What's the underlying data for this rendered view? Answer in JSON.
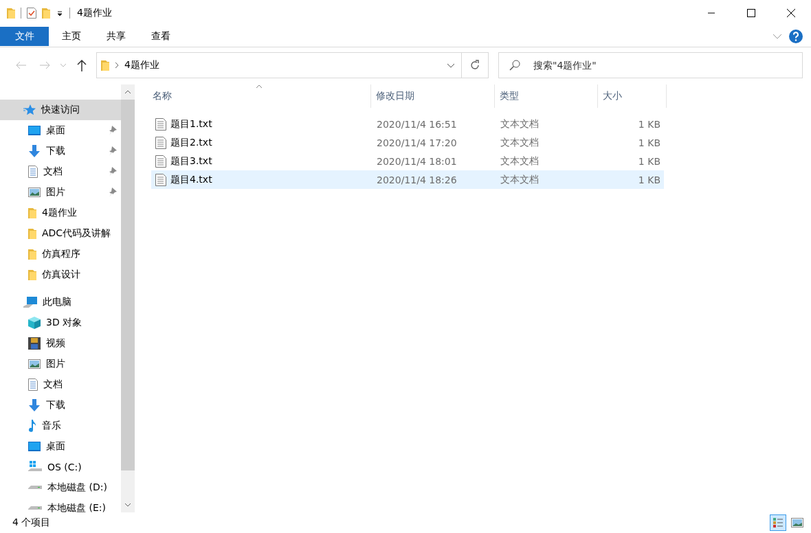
{
  "title_bar": {
    "title": "4题作业"
  },
  "ribbon": {
    "tabs": [
      {
        "label": "文件",
        "kind": "file"
      },
      {
        "label": "主页",
        "kind": "tab"
      },
      {
        "label": "共享",
        "kind": "tab"
      },
      {
        "label": "查看",
        "kind": "tab"
      }
    ]
  },
  "address_bar": {
    "path": "4题作业"
  },
  "search": {
    "placeholder": "搜索\"4题作业\""
  },
  "sidebar": {
    "items": [
      {
        "label": "快速访问",
        "kind": "star",
        "selected": true,
        "children": [
          {
            "label": "桌面",
            "kind": "desktop",
            "pinned": true,
            "selected": false
          },
          {
            "label": "下载",
            "kind": "download",
            "pinned": true,
            "selected": false
          },
          {
            "label": "文档",
            "kind": "document",
            "pinned": true,
            "selected": false
          },
          {
            "label": "图片",
            "kind": "picture",
            "pinned": true,
            "selected": false
          },
          {
            "label": "4题作业",
            "kind": "folder",
            "pinned": false,
            "selected": false
          },
          {
            "label": "ADC代码及讲解",
            "kind": "folder",
            "pinned": false,
            "selected": false
          },
          {
            "label": "仿真程序",
            "kind": "folder",
            "pinned": false,
            "selected": false
          },
          {
            "label": "仿真设计",
            "kind": "folder",
            "pinned": false,
            "selected": false
          }
        ]
      },
      {
        "label": "此电脑",
        "kind": "pc",
        "selected": false,
        "children": [
          {
            "label": "3D 对象",
            "kind": "cube",
            "pinned": false,
            "selected": false
          },
          {
            "label": "视频",
            "kind": "video",
            "pinned": false,
            "selected": false
          },
          {
            "label": "图片",
            "kind": "picture",
            "pinned": false,
            "selected": false
          },
          {
            "label": "文档",
            "kind": "document",
            "pinned": false,
            "selected": false
          },
          {
            "label": "下载",
            "kind": "download",
            "pinned": false,
            "selected": false
          },
          {
            "label": "音乐",
            "kind": "music",
            "pinned": false,
            "selected": false
          },
          {
            "label": "桌面",
            "kind": "desktop",
            "pinned": false,
            "selected": false
          },
          {
            "label": "OS (C:)",
            "kind": "windrive",
            "pinned": false,
            "selected": false
          },
          {
            "label": "本地磁盘 (D:)",
            "kind": "drive",
            "pinned": false,
            "selected": false
          },
          {
            "label": "本地磁盘 (E:)",
            "kind": "drive",
            "pinned": false,
            "selected": false
          }
        ]
      }
    ]
  },
  "file_list": {
    "columns": [
      {
        "label": "名称",
        "sorted": true
      },
      {
        "label": "修改日期",
        "sorted": false
      },
      {
        "label": "类型",
        "sorted": false
      },
      {
        "label": "大小",
        "sorted": false
      }
    ],
    "rows": [
      {
        "name": "题目1.txt",
        "date": "2020/11/4 16:51",
        "type": "文本文档",
        "size": "1 KB",
        "selected": false
      },
      {
        "name": "题目2.txt",
        "date": "2020/11/4 17:20",
        "type": "文本文档",
        "size": "1 KB",
        "selected": false
      },
      {
        "name": "题目3.txt",
        "date": "2020/11/4 18:01",
        "type": "文本文档",
        "size": "1 KB",
        "selected": false
      },
      {
        "name": "题目4.txt",
        "date": "2020/11/4 18:26",
        "type": "文本文档",
        "size": "1 KB",
        "selected": true
      }
    ]
  },
  "status_bar": {
    "count": "4 个项目",
    "views": [
      {
        "kind": "details",
        "selected": true
      },
      {
        "kind": "thumbnails",
        "selected": false
      }
    ]
  }
}
